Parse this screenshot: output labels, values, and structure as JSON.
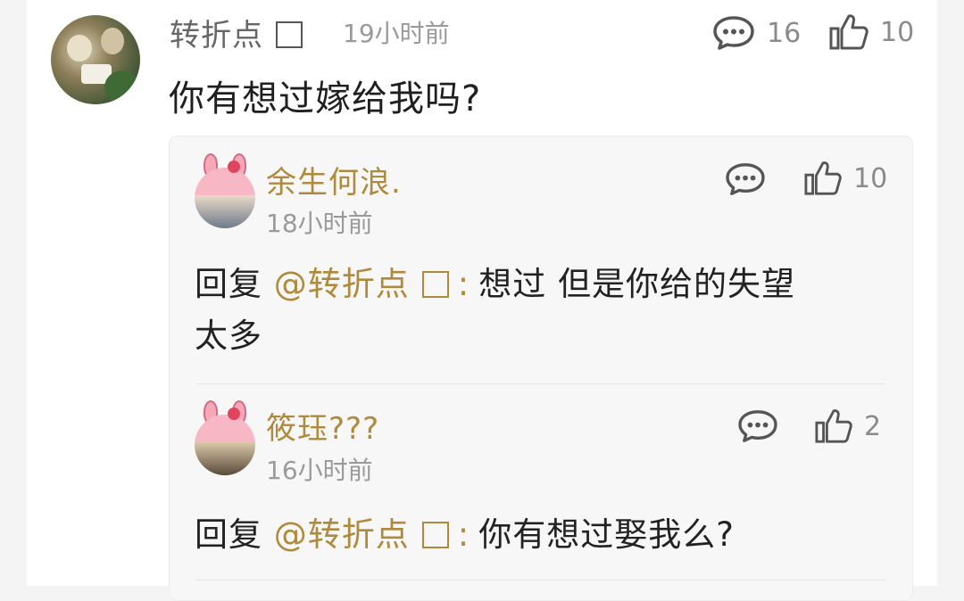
{
  "comment": {
    "author": "转折点",
    "time": "19小时前",
    "text": "你有想过嫁给我吗?",
    "reply_count": "16",
    "like_count": "10"
  },
  "replies": [
    {
      "author": "余生何浪.",
      "time": "18小时前",
      "like_count": "10",
      "prefix": "回复",
      "mention": "@转折点",
      "colon": ":",
      "text_line1": "想过 但是你给的失望",
      "text_line2": "太多"
    },
    {
      "author": "筱珏???",
      "time": "16小时前",
      "like_count": "2",
      "prefix": "回复",
      "mention": "@转折点",
      "colon": ":",
      "text_line1": "你有想过娶我么?"
    }
  ],
  "colors": {
    "username_reply": "#b08a3c",
    "meta_gray": "#9a9a9a",
    "icon_gray": "#555555"
  },
  "icons": [
    "comment-icon",
    "thumbs-up-icon"
  ]
}
